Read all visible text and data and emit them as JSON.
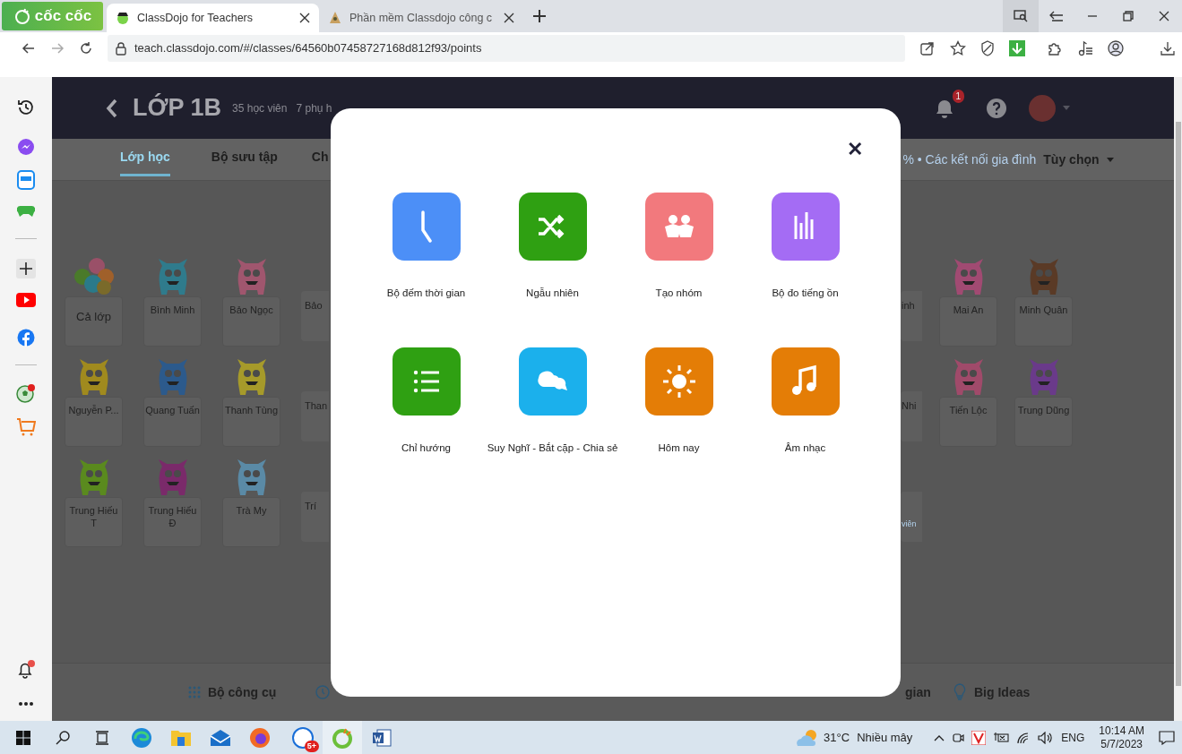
{
  "browser": {
    "logo": "cốc cốc",
    "tabs": [
      {
        "title": "ClassDojo for Teachers",
        "selected": true
      },
      {
        "title": "Phần mềm Classdojo công c",
        "selected": false
      }
    ],
    "url": "teach.classdojo.com/#/classes/64560b07458727168d812f93/points"
  },
  "header": {
    "class_name": "LỚP 1B",
    "students": "35 học viên",
    "parents": "7 phụ h",
    "notification_count": "1"
  },
  "nav": {
    "tabs": [
      {
        "label": "Lớp học",
        "selected": true
      },
      {
        "label": "Bộ sưu tập",
        "selected": false
      },
      {
        "label": "Ch",
        "selected": false
      }
    ],
    "connections": "% • Các kết nối gia đình",
    "options": "Tùy chọn"
  },
  "student_rows": [
    {
      "left": [
        {
          "kind": "class",
          "name": "Cả lớp"
        },
        {
          "kind": "student",
          "name": "Bình Minh",
          "color": "#2f7b8c"
        },
        {
          "kind": "student",
          "name": "Bảo Ngọc",
          "color": "#a0566e"
        },
        {
          "kind": "cut",
          "name": "Bảo"
        }
      ],
      "right": [
        {
          "kind": "cut",
          "name": "inh"
        },
        {
          "kind": "student",
          "name": "Mai An",
          "color": "#a14a72"
        },
        {
          "kind": "student",
          "name": "Minh Quân",
          "color": "#5a3a26"
        }
      ]
    },
    {
      "left": [
        {
          "kind": "student",
          "name": "Nguyễn P...",
          "color": "#a08a1e"
        },
        {
          "kind": "student",
          "name": "Quang Tuấn",
          "color": "#2c5a8c"
        },
        {
          "kind": "student",
          "name": "Thanh Tùng",
          "color": "#a69a2a"
        },
        {
          "kind": "cut",
          "name": "Than"
        }
      ],
      "right": [
        {
          "kind": "cut",
          "name": "Nhi"
        },
        {
          "kind": "student",
          "name": "Tiến Lộc",
          "color": "#a04a6a"
        },
        {
          "kind": "student",
          "name": "Trung Dũng",
          "color": "#6a3a8a"
        }
      ]
    },
    {
      "left": [
        {
          "kind": "student",
          "name": "Trung Hiếu T",
          "color": "#5a8a1e"
        },
        {
          "kind": "student",
          "name": "Trung Hiếu Đ",
          "color": "#7a2a6a"
        },
        {
          "kind": "student",
          "name": "Trà My",
          "color": "#5a8aa6"
        },
        {
          "kind": "cut",
          "name": "Trí"
        }
      ],
      "right": [
        {
          "kind": "cut_link",
          "name": "viên"
        }
      ]
    }
  ],
  "modal": {
    "close": "✕",
    "tools": [
      {
        "label": "Bộ đếm thời gian",
        "color": "#4c8ff7"
      },
      {
        "label": "Ngẫu nhiên",
        "color": "#2fa012"
      },
      {
        "label": "Tạo nhóm",
        "color": "#f2797d"
      },
      {
        "label": "Bộ đo tiếng ồn",
        "color": "#a46cf4"
      },
      {
        "label": "Chỉ hướng",
        "color": "#2fa012"
      },
      {
        "label": "Suy Nghĩ - Bắt cặp - Chia sẻ",
        "color": "#1bb0ec"
      },
      {
        "label": "Hôm nay",
        "color": "#e47d06"
      },
      {
        "label": "Âm nhạc",
        "color": "#e47d06"
      }
    ]
  },
  "toolbar": [
    {
      "label": "Bộ công cụ"
    },
    {
      "label": "gian"
    },
    {
      "label": "Big Ideas"
    }
  ],
  "taskbar": {
    "zalo_badge": "5+",
    "temperature": "31°C",
    "weather": "Nhiều mây",
    "language": "ENG",
    "time": "10:14 AM",
    "date": "5/7/2023"
  }
}
